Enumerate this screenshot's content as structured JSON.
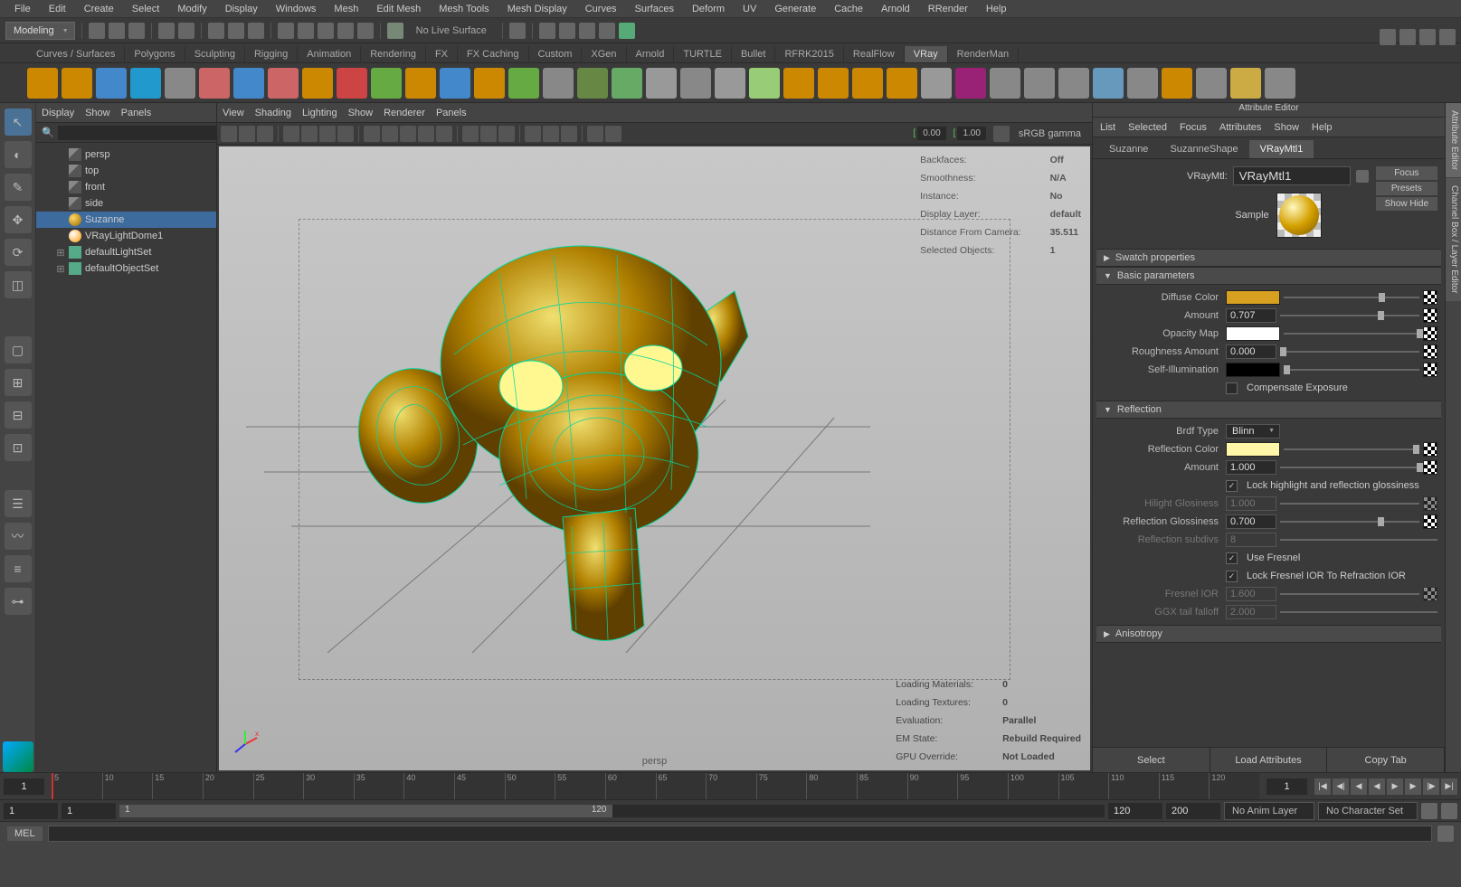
{
  "menubar": [
    "File",
    "Edit",
    "Create",
    "Select",
    "Modify",
    "Display",
    "Windows",
    "Mesh",
    "Edit Mesh",
    "Mesh Tools",
    "Mesh Display",
    "Curves",
    "Surfaces",
    "Deform",
    "UV",
    "Generate",
    "Cache",
    "Arnold",
    "RRender",
    "Help"
  ],
  "workspace": "Modeling",
  "noLiveSurface": "No Live Surface",
  "shelfTabs": [
    "Curves / Surfaces",
    "Polygons",
    "Sculpting",
    "Rigging",
    "Animation",
    "Rendering",
    "FX",
    "FX Caching",
    "Custom",
    "XGen",
    "Arnold",
    "TURTLE",
    "Bullet",
    "RFRK2015",
    "RealFlow",
    "VRay",
    "RenderMan"
  ],
  "shelfActive": "VRay",
  "outlinerMenu": [
    "Display",
    "Show",
    "Panels"
  ],
  "outliner": [
    {
      "type": "cam",
      "label": "persp",
      "indent": 1
    },
    {
      "type": "cam",
      "label": "top",
      "indent": 1
    },
    {
      "type": "cam",
      "label": "front",
      "indent": 1
    },
    {
      "type": "cam",
      "label": "side",
      "indent": 1
    },
    {
      "type": "mesh",
      "label": "Suzanne",
      "indent": 1,
      "sel": true
    },
    {
      "type": "light",
      "label": "VRayLightDome1",
      "indent": 1
    },
    {
      "type": "set",
      "label": "defaultLightSet",
      "indent": 1,
      "exp": true
    },
    {
      "type": "set",
      "label": "defaultObjectSet",
      "indent": 1,
      "exp": true
    }
  ],
  "vpMenu": [
    "View",
    "Shading",
    "Lighting",
    "Show",
    "Renderer",
    "Panels"
  ],
  "vpGamma": "sRGB gamma",
  "vpExp": "0.00",
  "vpGammaVal": "1.00",
  "vpInfoTop": [
    [
      "Backfaces:",
      "Off"
    ],
    [
      "Smoothness:",
      "N/A"
    ],
    [
      "Instance:",
      "No"
    ],
    [
      "Display Layer:",
      "default"
    ],
    [
      "Distance From Camera:",
      "35.511"
    ],
    [
      "Selected Objects:",
      "1"
    ]
  ],
  "vpInfoBot": [
    [
      "Loading Materials:",
      "0"
    ],
    [
      "Loading Textures:",
      "0"
    ],
    [
      "Evaluation:",
      "Parallel"
    ],
    [
      "EM State:",
      "Rebuild Required"
    ],
    [
      "GPU Override:",
      "Not Loaded"
    ]
  ],
  "vpCamera": "persp",
  "aeTitle": "Attribute Editor",
  "aeMenu": [
    "List",
    "Selected",
    "Focus",
    "Attributes",
    "Show",
    "Help"
  ],
  "aeTabs": [
    "Suzanne",
    "SuzanneShape",
    "VRayMtl1"
  ],
  "aeTabActive": "VRayMtl1",
  "aeNameLabel": "VRayMtl:",
  "aeNameVal": "VRayMtl1",
  "aeSideButtons": [
    "Focus",
    "Presets",
    "Show  Hide"
  ],
  "aeSampleLabel": "Sample",
  "sec1": "Swatch properties",
  "sec2": "Basic parameters",
  "sec3": "Reflection",
  "sec4": "Anisotropy",
  "basic": {
    "diffuseColor": "Diffuse Color",
    "diffuseHex": "#d8a020",
    "amount": "Amount",
    "amountVal": "0.707",
    "opacityMap": "Opacity Map",
    "opacityHex": "#ffffff",
    "rough": "Roughness Amount",
    "roughVal": "0.000",
    "selfIllum": "Self-Illumination",
    "selfHex": "#000000",
    "compExp": "Compensate Exposure"
  },
  "refl": {
    "brdfType": "Brdf Type",
    "brdfVal": "Blinn",
    "reflColor": "Reflection Color",
    "reflHex": "#fff6a8",
    "amount": "Amount",
    "amountVal": "1.000",
    "lockHL": "Lock highlight and reflection glossiness",
    "hilight": "Hilight Glosiness",
    "hilightVal": "1.000",
    "reflGloss": "Reflection Glossiness",
    "reflGlossVal": "0.700",
    "subdivs": "Reflection subdivs",
    "subdivsVal": "8",
    "fresnel": "Use Fresnel",
    "lockIOR": "Lock Fresnel IOR To Refraction IOR",
    "fresnelIOR": "Fresnel IOR",
    "fresnelIORVal": "1.600",
    "ggx": "GGX tail falloff",
    "ggxVal": "2.000"
  },
  "aeBottom": [
    "Select",
    "Load Attributes",
    "Copy Tab"
  ],
  "sideTabs": [
    "Attribute Editor",
    "Channel Box / Layer Editor"
  ],
  "timeline": {
    "start": "1",
    "end": "120",
    "rangeStart": "1",
    "rangeEnd": "120",
    "cur": "1",
    "total": "200",
    "animLayer": "No Anim Layer",
    "charSet": "No Character Set"
  },
  "cmd": "MEL"
}
